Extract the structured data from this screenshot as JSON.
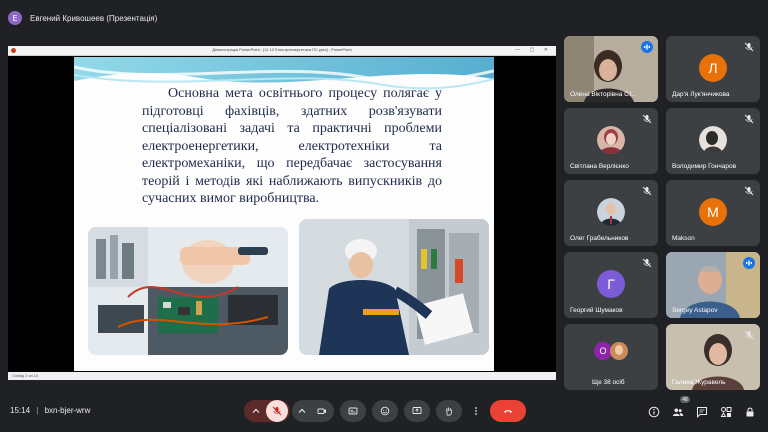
{
  "meeting": {
    "presenter_initial": "Е",
    "presenter_title": "Евгений Кривошеев (Презентація)",
    "time": "15:14",
    "separator": "|",
    "code": "bxn-bjer-wrw",
    "participants_count": "48"
  },
  "presentation": {
    "window_title": "Демонстрація PowerPoint - [11 12 Електроенергетика ПС.pptx] - PowerPoint",
    "slide_text": "Основна мета освітнього процесу полягає у підготовці фахівців, здатних розв'язувати спеціалізовані задачі та практичні проблеми електроенергетики, електротехніки та електромеханіки, що передбачає застосування теорій і методів які наближають випускників до сучасних вимог виробництва.",
    "status": "Слайд 2 из 10"
  },
  "participants": [
    {
      "name": "Олена Вікторівна Ст...",
      "initial": "",
      "color": "",
      "state": "speaking"
    },
    {
      "name": "Дар'я Лук'янчикова",
      "initial": "Л",
      "color": "#e8710a",
      "state": "muted"
    },
    {
      "name": "Світлана Верлієнко",
      "initial": "",
      "color": "",
      "state": "muted"
    },
    {
      "name": "Володимир Гончаров",
      "initial": "",
      "color": "",
      "state": "muted"
    },
    {
      "name": "Олег Грабельников",
      "initial": "",
      "color": "",
      "state": "muted"
    },
    {
      "name": "Makson",
      "initial": "M",
      "color": "#e8710a",
      "state": "muted"
    },
    {
      "name": "Георгий Шумаков",
      "initial": "Г",
      "color": "#7b5cd6",
      "state": "muted"
    },
    {
      "name": "Sergey Astapov",
      "initial": "",
      "color": "",
      "state": "speaking"
    },
    {
      "name": "Ще 38 осіб",
      "initial": "О",
      "color": "#8e24aa",
      "state": ""
    },
    {
      "name": "Галина Журавель",
      "initial": "",
      "color": "",
      "state": "muted"
    }
  ],
  "colors": {
    "background": "#202124",
    "tile": "#3c4043",
    "end_call": "#ea4335",
    "mic_off": "#f28b82",
    "accent": "#8ab4f8"
  },
  "icons": [
    "chevron-up-icon",
    "mic-off-icon",
    "camera-icon",
    "captions-icon",
    "emoji-icon",
    "present-icon",
    "raise-hand-icon",
    "more-icon",
    "end-call-icon",
    "info-icon",
    "people-icon",
    "chat-icon",
    "activities-icon",
    "lock-icon"
  ]
}
